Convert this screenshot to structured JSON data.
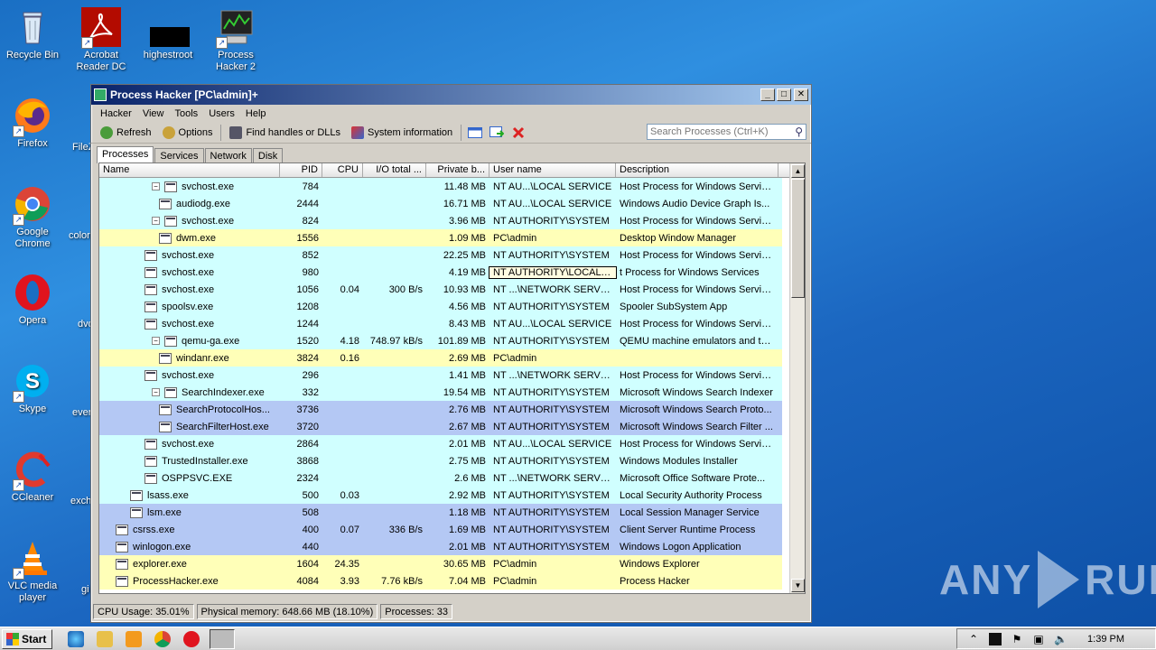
{
  "desktop": {
    "icons": [
      {
        "label": "Recycle Bin"
      },
      {
        "label": "Acrobat Reader DC"
      },
      {
        "label": "highestroot"
      },
      {
        "label": "Process Hacker 2"
      },
      {
        "label": "Firefox"
      },
      {
        "label": "Google Chrome"
      },
      {
        "label": "Opera"
      },
      {
        "label": "Skype"
      },
      {
        "label": "CCleaner"
      },
      {
        "label": "VLC media player"
      }
    ],
    "partial_labels": [
      "FileZ",
      "color",
      "dvd",
      "ever",
      "exch",
      "gi"
    ]
  },
  "window": {
    "title": "Process Hacker [PC\\admin]+",
    "menu": [
      "Hacker",
      "View",
      "Tools",
      "Users",
      "Help"
    ],
    "toolbar": {
      "refresh": "Refresh",
      "options": "Options",
      "find": "Find handles or DLLs",
      "sysinfo": "System information"
    },
    "search_placeholder": "Search Processes (Ctrl+K)",
    "tabs": [
      "Processes",
      "Services",
      "Network",
      "Disk"
    ],
    "columns": [
      "Name",
      "PID",
      "CPU",
      "I/O total ...",
      "Private b...",
      "User name",
      "Description"
    ],
    "rows": [
      {
        "name": "svchost.exe",
        "pid": "784",
        "cpu": "",
        "io": "",
        "priv": "11.48 MB",
        "user": "NT AU...\\LOCAL SERVICE",
        "desc": "Host Process for Windows Services",
        "indent": 2,
        "exp": "−",
        "bg": "svc"
      },
      {
        "name": "audiodg.exe",
        "pid": "2444",
        "cpu": "",
        "io": "",
        "priv": "16.71 MB",
        "user": "NT AU...\\LOCAL SERVICE",
        "desc": "Windows Audio Device Graph Is...",
        "indent": 3,
        "exp": "",
        "bg": "svc"
      },
      {
        "name": "svchost.exe",
        "pid": "824",
        "cpu": "",
        "io": "",
        "priv": "3.96 MB",
        "user": "NT AUTHORITY\\SYSTEM",
        "desc": "Host Process for Windows Services",
        "indent": 2,
        "exp": "−",
        "bg": "svc"
      },
      {
        "name": "dwm.exe",
        "pid": "1556",
        "cpu": "",
        "io": "",
        "priv": "1.09 MB",
        "user": "PC\\admin",
        "desc": "Desktop Window Manager",
        "indent": 3,
        "exp": "",
        "bg": "user"
      },
      {
        "name": "svchost.exe",
        "pid": "852",
        "cpu": "",
        "io": "",
        "priv": "22.25 MB",
        "user": "NT AUTHORITY\\SYSTEM",
        "desc": "Host Process for Windows Services",
        "indent": 2,
        "exp": "",
        "bg": "svc"
      },
      {
        "name": "svchost.exe",
        "pid": "980",
        "cpu": "",
        "io": "",
        "priv": "4.19 MB",
        "user": "NT AUTHORITY\\LOCAL SERVICE",
        "desc": "t Process for Windows Services",
        "indent": 2,
        "exp": "",
        "bg": "svc",
        "hover": true
      },
      {
        "name": "svchost.exe",
        "pid": "1056",
        "cpu": "0.04",
        "io": "300 B/s",
        "priv": "10.93 MB",
        "user": "NT ...\\NETWORK SERVICE",
        "desc": "Host Process for Windows Services",
        "indent": 2,
        "exp": "",
        "bg": "svc"
      },
      {
        "name": "spoolsv.exe",
        "pid": "1208",
        "cpu": "",
        "io": "",
        "priv": "4.56 MB",
        "user": "NT AUTHORITY\\SYSTEM",
        "desc": "Spooler SubSystem App",
        "indent": 2,
        "exp": "",
        "bg": "svc"
      },
      {
        "name": "svchost.exe",
        "pid": "1244",
        "cpu": "",
        "io": "",
        "priv": "8.43 MB",
        "user": "NT AU...\\LOCAL SERVICE",
        "desc": "Host Process for Windows Services",
        "indent": 2,
        "exp": "",
        "bg": "svc"
      },
      {
        "name": "qemu-ga.exe",
        "pid": "1520",
        "cpu": "4.18",
        "io": "748.97 kB/s",
        "priv": "101.89 MB",
        "user": "NT AUTHORITY\\SYSTEM",
        "desc": "QEMU machine emulators and tools",
        "indent": 2,
        "exp": "−",
        "bg": "svc"
      },
      {
        "name": "windanr.exe",
        "pid": "3824",
        "cpu": "0.16",
        "io": "",
        "priv": "2.69 MB",
        "user": "PC\\admin",
        "desc": "",
        "indent": 3,
        "exp": "",
        "bg": "user"
      },
      {
        "name": "svchost.exe",
        "pid": "296",
        "cpu": "",
        "io": "",
        "priv": "1.41 MB",
        "user": "NT ...\\NETWORK SERVICE",
        "desc": "Host Process for Windows Services",
        "indent": 2,
        "exp": "",
        "bg": "svc"
      },
      {
        "name": "SearchIndexer.exe",
        "pid": "332",
        "cpu": "",
        "io": "",
        "priv": "19.54 MB",
        "user": "NT AUTHORITY\\SYSTEM",
        "desc": "Microsoft Windows Search Indexer",
        "indent": 2,
        "exp": "−",
        "bg": "svc"
      },
      {
        "name": "SearchProtocolHos...",
        "pid": "3736",
        "cpu": "",
        "io": "",
        "priv": "2.76 MB",
        "user": "NT AUTHORITY\\SYSTEM",
        "desc": "Microsoft Windows Search Proto...",
        "indent": 3,
        "exp": "",
        "bg": "sys"
      },
      {
        "name": "SearchFilterHost.exe",
        "pid": "3720",
        "cpu": "",
        "io": "",
        "priv": "2.67 MB",
        "user": "NT AUTHORITY\\SYSTEM",
        "desc": "Microsoft Windows Search Filter ...",
        "indent": 3,
        "exp": "",
        "bg": "sys"
      },
      {
        "name": "svchost.exe",
        "pid": "2864",
        "cpu": "",
        "io": "",
        "priv": "2.01 MB",
        "user": "NT AU...\\LOCAL SERVICE",
        "desc": "Host Process for Windows Services",
        "indent": 2,
        "exp": "",
        "bg": "svc"
      },
      {
        "name": "TrustedInstaller.exe",
        "pid": "3868",
        "cpu": "",
        "io": "",
        "priv": "2.75 MB",
        "user": "NT AUTHORITY\\SYSTEM",
        "desc": "Windows Modules Installer",
        "indent": 2,
        "exp": "",
        "bg": "svc"
      },
      {
        "name": "OSPPSVC.EXE",
        "pid": "2324",
        "cpu": "",
        "io": "",
        "priv": "2.6 MB",
        "user": "NT ...\\NETWORK SERVICE",
        "desc": "Microsoft Office Software Prote...",
        "indent": 2,
        "exp": "",
        "bg": "svc"
      },
      {
        "name": "lsass.exe",
        "pid": "500",
        "cpu": "0.03",
        "io": "",
        "priv": "2.92 MB",
        "user": "NT AUTHORITY\\SYSTEM",
        "desc": "Local Security Authority Process",
        "indent": 1,
        "exp": "",
        "bg": "svc"
      },
      {
        "name": "lsm.exe",
        "pid": "508",
        "cpu": "",
        "io": "",
        "priv": "1.18 MB",
        "user": "NT AUTHORITY\\SYSTEM",
        "desc": "Local Session Manager Service",
        "indent": 1,
        "exp": "",
        "bg": "sys"
      },
      {
        "name": "csrss.exe",
        "pid": "400",
        "cpu": "0.07",
        "io": "336 B/s",
        "priv": "1.69 MB",
        "user": "NT AUTHORITY\\SYSTEM",
        "desc": "Client Server Runtime Process",
        "indent": 0,
        "exp": "",
        "bg": "sys"
      },
      {
        "name": "winlogon.exe",
        "pid": "440",
        "cpu": "",
        "io": "",
        "priv": "2.01 MB",
        "user": "NT AUTHORITY\\SYSTEM",
        "desc": "Windows Logon Application",
        "indent": 0,
        "exp": "",
        "bg": "sys"
      },
      {
        "name": "explorer.exe",
        "pid": "1604",
        "cpu": "24.35",
        "io": "",
        "priv": "30.65 MB",
        "user": "PC\\admin",
        "desc": "Windows Explorer",
        "indent": 0,
        "exp": "",
        "bg": "user"
      },
      {
        "name": "ProcessHacker.exe",
        "pid": "4084",
        "cpu": "3.93",
        "io": "7.76 kB/s",
        "priv": "7.04 MB",
        "user": "PC\\admin",
        "desc": "Process Hacker",
        "indent": 0,
        "exp": "",
        "bg": "user"
      }
    ],
    "status": {
      "cpu": "CPU Usage: 35.01%",
      "memory": "Physical memory: 648.66 MB (18.10%)",
      "processes": "Processes: 33"
    }
  },
  "watermark": {
    "left": "ANY",
    "right": "RUN"
  },
  "taskbar": {
    "start_label": "Start",
    "clock": "1:39 PM"
  }
}
